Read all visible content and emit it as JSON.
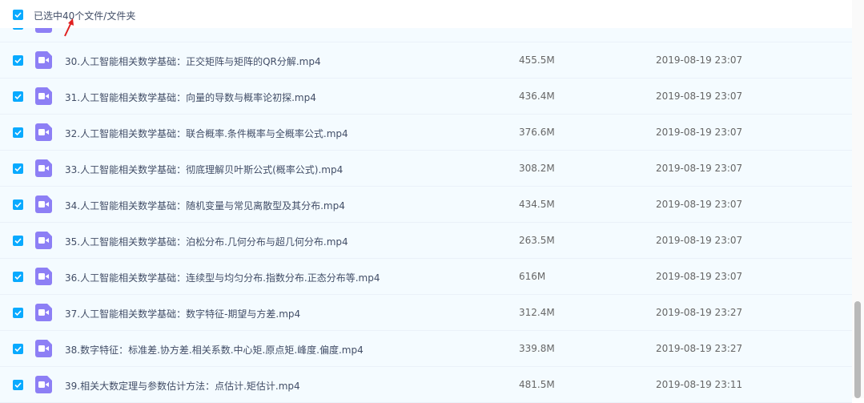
{
  "header": {
    "selection_text": "已选中40个文件/文件夹"
  },
  "files": [
    {
      "name": "30.人工智能相关数学基础：正交矩阵与矩阵的QR分解.mp4",
      "size": "455.5M",
      "time": "2019-08-19 23:07"
    },
    {
      "name": "31.人工智能相关数学基础：向量的导数与概率论初探.mp4",
      "size": "436.4M",
      "time": "2019-08-19 23:07"
    },
    {
      "name": "32.人工智能相关数学基础：联合概率.条件概率与全概率公式.mp4",
      "size": "376.6M",
      "time": "2019-08-19 23:07"
    },
    {
      "name": "33.人工智能相关数学基础：彻底理解贝叶斯公式(概率公式).mp4",
      "size": "308.2M",
      "time": "2019-08-19 23:07"
    },
    {
      "name": "34.人工智能相关数学基础：随机变量与常见离散型及其分布.mp4",
      "size": "434.5M",
      "time": "2019-08-19 23:07"
    },
    {
      "name": "35.人工智能相关数学基础：泊松分布.几何分布与超几何分布.mp4",
      "size": "263.5M",
      "time": "2019-08-19 23:07"
    },
    {
      "name": "36.人工智能相关数学基础：连续型与均匀分布.指数分布.正态分布等.mp4",
      "size": "616M",
      "time": "2019-08-19 23:07"
    },
    {
      "name": "37.人工智能相关数学基础：数字特征-期望与方差.mp4",
      "size": "312.4M",
      "time": "2019-08-19 23:27"
    },
    {
      "name": "38.数字特征：标准差.协方差.相关系数.中心矩.原点矩.峰度.偏度.mp4",
      "size": "339.8M",
      "time": "2019-08-19 23:27"
    },
    {
      "name": "39.相关大数定理与参数估计方法：点估计.矩估计.mp4",
      "size": "481.5M",
      "time": "2019-08-19 23:11"
    }
  ],
  "colors": {
    "checkbox": "#09aaff",
    "video_icon": "#8d7ff5",
    "row_selected_bg": "#f4fbff",
    "annotation_arrow": "#e02020"
  },
  "icons": {
    "checkbox": "check-icon",
    "file": "video-file-icon",
    "annotation": "red-arrow-icon"
  }
}
